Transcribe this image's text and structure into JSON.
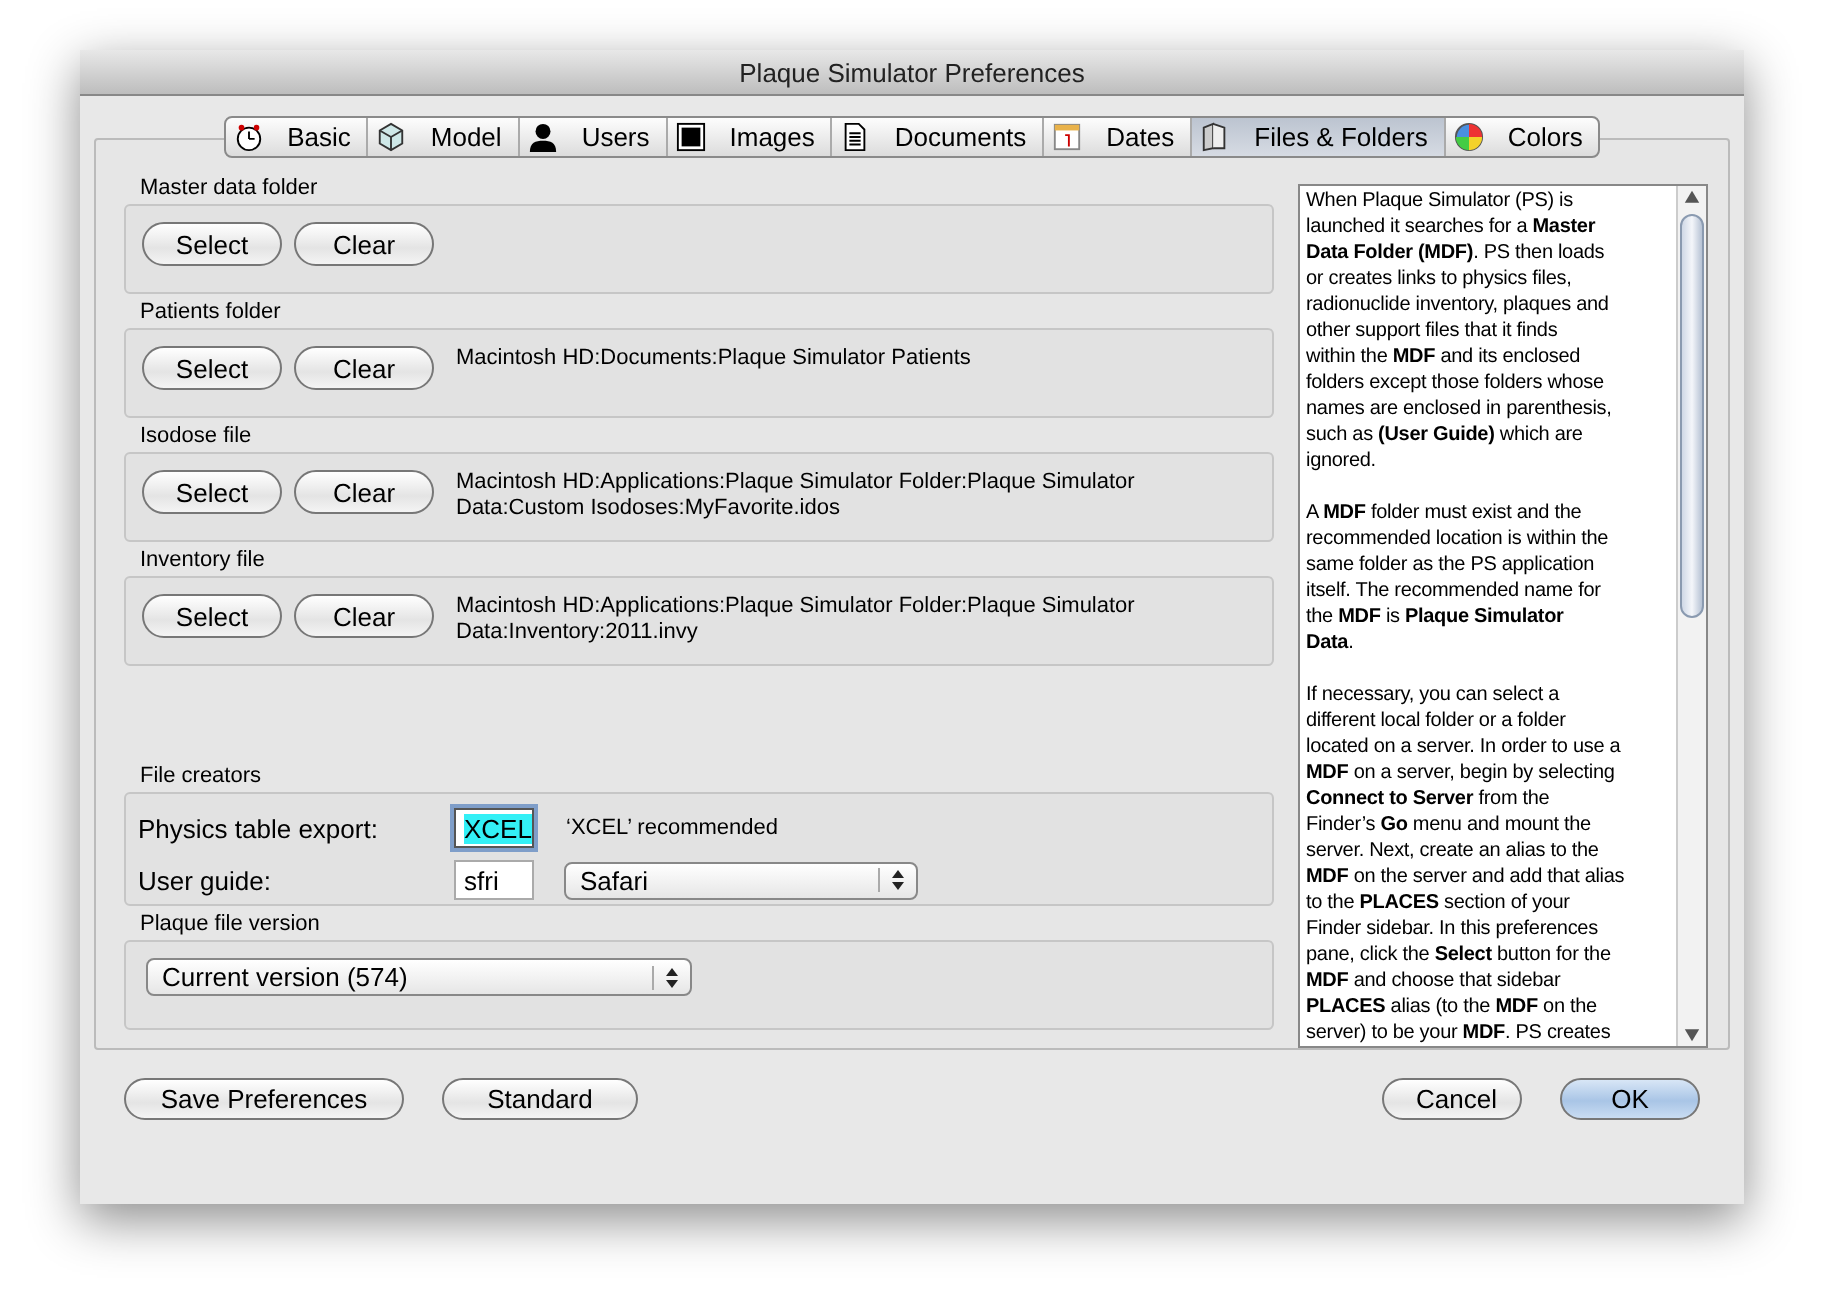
{
  "window": {
    "title": "Plaque Simulator Preferences"
  },
  "tabs": [
    {
      "label": "Basic",
      "selected": false
    },
    {
      "label": "Model",
      "selected": false
    },
    {
      "label": "Users",
      "selected": false
    },
    {
      "label": "Images",
      "selected": false
    },
    {
      "label": "Documents",
      "selected": false
    },
    {
      "label": "Dates",
      "selected": false
    },
    {
      "label": "Files & Folders",
      "selected": true
    },
    {
      "label": "Colors",
      "selected": false
    }
  ],
  "file_sections": [
    {
      "label": "Master data folder",
      "buttons": [
        "Select",
        "Clear"
      ]
    },
    {
      "label": "Patients folder",
      "buttons": [
        "Select",
        "Clear"
      ],
      "path": "Macintosh HD:Documents:Plaque Simulator Patients"
    },
    {
      "label": "Isodose file",
      "buttons": [
        "Select",
        "Clear"
      ],
      "path": "Macintosh HD:Applications:Plaque Simulator Folder:Plaque Simulator Data:Custom Isodoses:MyFavorite.idos"
    },
    {
      "label": "Inventory file",
      "buttons": [
        "Select",
        "Clear"
      ],
      "path": "Macintosh HD:Applications:Plaque Simulator Folder:Plaque Simulator Data:Inventory:2011.invy"
    }
  ],
  "file_creators": {
    "label": "File creators",
    "physics": {
      "label": "Physics table export:",
      "value": "XCEL",
      "selected": true,
      "note": "‘XCEL’ recommended"
    },
    "user_guide": {
      "label": "User guide:",
      "value": "sfri",
      "app": "Safari"
    }
  },
  "plaque_file_version": {
    "label": "Plaque file version",
    "value": "Current version (574)"
  },
  "help": {
    "paragraphs": [
      [
        "When Plaque Simulator (PS) is",
        "launched it searches for a **Master**",
        "**Data Folder (MDF)**. PS then loads",
        "or creates links to physics files,",
        "radionuclide inventory, plaques and",
        "other support files that it finds",
        "within the **MDF** and its enclosed",
        "folders except those folders whose",
        "names are enclosed in parenthesis,",
        "such as **(User Guide)** which are",
        "ignored."
      ],
      [
        "A **MDF** folder must exist and the",
        "recommended location is within the",
        "same folder as the PS application",
        "itself.  The recommended name for",
        "the **MDF** is **Plaque Simulator**",
        "**Data**."
      ],
      [
        "If necessary, you can select a",
        "different local folder or a folder",
        "located on a server.  In order to use a",
        "**MDF** on a server, begin by selecting",
        "**Connect to Server** from the",
        "Finder’s **Go** menu and mount the",
        "server. Next, create an alias to the",
        "**MDF** on the server and add that alias",
        "to the **PLACES** section of your",
        "Finder sidebar. In this preferences",
        "pane, click the **Select** button for the",
        "**MDF** and choose that sidebar",
        "**PLACES** alias (to the **MDF** on the",
        "server) to be your **MDF**.  PS creates"
      ]
    ]
  },
  "footer_buttons": [
    {
      "label": "Save Preferences",
      "default": false
    },
    {
      "label": "Standard",
      "default": false
    },
    {
      "label": "Cancel",
      "default": false
    },
    {
      "label": "OK",
      "default": true
    }
  ]
}
